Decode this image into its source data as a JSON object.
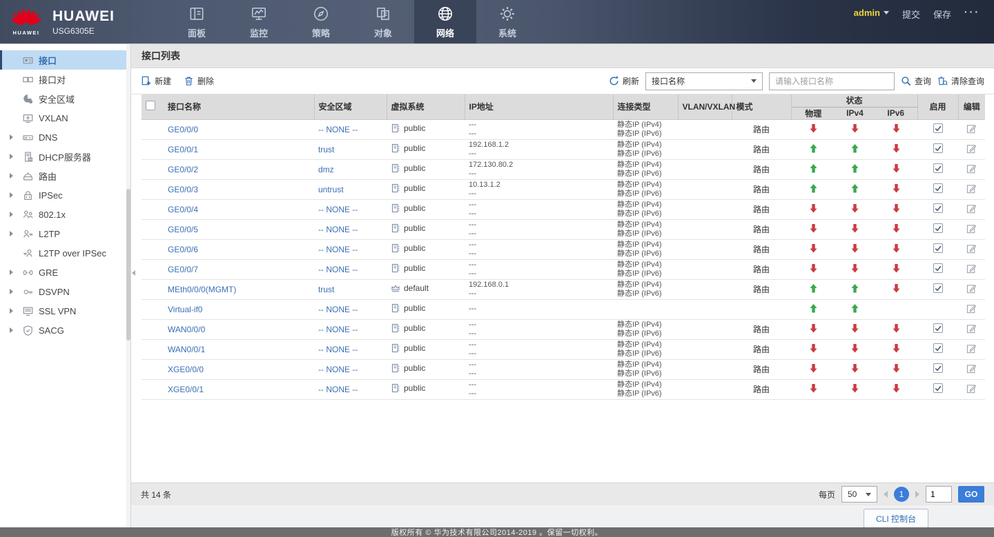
{
  "colors": {
    "brand_red": "#e2001a",
    "accent_blue": "#2f6eb5",
    "link_blue": "#3a6fb5",
    "up_green": "#3aa84c",
    "down_red": "#cc3a41",
    "admin_yellow": "#f0d43c",
    "go_blue": "#3b7dd8",
    "selected_bg": "#bfdbf3"
  },
  "brand": {
    "logo_caption": "HUAWEI",
    "name": "HUAWEI",
    "model": "USG6305E"
  },
  "topnav": {
    "items": [
      {
        "id": "dashboard",
        "label": "面板",
        "icon": "dashboard-icon",
        "active": false
      },
      {
        "id": "monitor",
        "label": "监控",
        "icon": "monitor-icon",
        "active": false
      },
      {
        "id": "policy",
        "label": "策略",
        "icon": "policy-icon",
        "active": false
      },
      {
        "id": "object",
        "label": "对象",
        "icon": "object-icon",
        "active": false
      },
      {
        "id": "network",
        "label": "网络",
        "icon": "network-icon",
        "active": true
      },
      {
        "id": "system",
        "label": "系统",
        "icon": "system-icon",
        "active": false
      }
    ],
    "user": "admin",
    "commit_label": "提交",
    "save_label": "保存",
    "more_label": "···"
  },
  "sidebar": {
    "items": [
      {
        "id": "interface",
        "label": "接口",
        "icon": "interface-icon",
        "selected": true,
        "expandable": false
      },
      {
        "id": "interface-pair",
        "label": "接口对",
        "icon": "interface-pair-icon",
        "selected": false,
        "expandable": false
      },
      {
        "id": "security-zone",
        "label": "安全区域",
        "icon": "zone-icon",
        "selected": false,
        "expandable": false
      },
      {
        "id": "vxlan",
        "label": "VXLAN",
        "icon": "vxlan-icon",
        "selected": false,
        "expandable": false
      },
      {
        "id": "dns",
        "label": "DNS",
        "icon": "dns-icon",
        "selected": false,
        "expandable": true
      },
      {
        "id": "dhcp-server",
        "label": "DHCP服务器",
        "icon": "dhcp-icon",
        "selected": false,
        "expandable": true
      },
      {
        "id": "route",
        "label": "路由",
        "icon": "route-icon",
        "selected": false,
        "expandable": true
      },
      {
        "id": "ipsec",
        "label": "IPSec",
        "icon": "ipsec-icon",
        "selected": false,
        "expandable": true
      },
      {
        "id": "8021x",
        "label": "802.1x",
        "icon": "dot1x-icon",
        "selected": false,
        "expandable": true
      },
      {
        "id": "l2tp",
        "label": "L2TP",
        "icon": "l2tp-icon",
        "selected": false,
        "expandable": true
      },
      {
        "id": "l2tp-over-ipsec",
        "label": "L2TP over IPSec",
        "icon": "l2tp-ipsec-icon",
        "selected": false,
        "expandable": false
      },
      {
        "id": "gre",
        "label": "GRE",
        "icon": "gre-icon",
        "selected": false,
        "expandable": true
      },
      {
        "id": "dsvpn",
        "label": "DSVPN",
        "icon": "dsvpn-icon",
        "selected": false,
        "expandable": true
      },
      {
        "id": "ssl-vpn",
        "label": "SSL VPN",
        "icon": "sslvpn-icon",
        "selected": false,
        "expandable": true
      },
      {
        "id": "sacg",
        "label": "SACG",
        "icon": "sacg-icon",
        "selected": false,
        "expandable": true
      }
    ]
  },
  "main": {
    "title": "接口列表",
    "toolbar": {
      "new_label": "新建",
      "delete_label": "删除",
      "refresh_label": "刷新",
      "filter_selected": "接口名称",
      "search_placeholder": "请输入接口名称",
      "query_label": "查询",
      "clear_query_label": "清除查询"
    },
    "table": {
      "headers": {
        "name": "接口名称",
        "zone": "安全区域",
        "vsys": "虚拟系统",
        "ip": "IP地址",
        "conn": "连接类型",
        "vlan": "VLAN/VXLAN",
        "mode": "模式",
        "status": "状态",
        "phys": "物理",
        "ipv4": "IPv4",
        "ipv6": "IPv6",
        "enable": "启用",
        "edit": "编辑"
      },
      "rows": [
        {
          "name": "GE0/0/0",
          "zone": "-- NONE --",
          "vsys": "public",
          "vsys_icon": "vsys-public-icon",
          "ip": [
            "---",
            "---"
          ],
          "conn": [
            "静态IP (IPv4)",
            "静态IP (IPv6)"
          ],
          "vlan": "",
          "mode": "路由",
          "status_phys": "down",
          "status_ipv4": "down",
          "status_ipv6": "down",
          "enabled": true
        },
        {
          "name": "GE0/0/1",
          "zone": "trust",
          "vsys": "public",
          "vsys_icon": "vsys-public-icon",
          "ip": [
            "192.168.1.2",
            "---"
          ],
          "conn": [
            "静态IP (IPv4)",
            "静态IP (IPv6)"
          ],
          "vlan": "",
          "mode": "路由",
          "status_phys": "up",
          "status_ipv4": "up",
          "status_ipv6": "down",
          "enabled": true
        },
        {
          "name": "GE0/0/2",
          "zone": "dmz",
          "vsys": "public",
          "vsys_icon": "vsys-public-icon",
          "ip": [
            "172.130.80.2",
            "---"
          ],
          "conn": [
            "静态IP (IPv4)",
            "静态IP (IPv6)"
          ],
          "vlan": "",
          "mode": "路由",
          "status_phys": "up",
          "status_ipv4": "up",
          "status_ipv6": "down",
          "enabled": true
        },
        {
          "name": "GE0/0/3",
          "zone": "untrust",
          "vsys": "public",
          "vsys_icon": "vsys-public-icon",
          "ip": [
            "10.13.1.2",
            "---"
          ],
          "conn": [
            "静态IP (IPv4)",
            "静态IP (IPv6)"
          ],
          "vlan": "",
          "mode": "路由",
          "status_phys": "up",
          "status_ipv4": "up",
          "status_ipv6": "down",
          "enabled": true
        },
        {
          "name": "GE0/0/4",
          "zone": "-- NONE --",
          "vsys": "public",
          "vsys_icon": "vsys-public-icon",
          "ip": [
            "---",
            "---"
          ],
          "conn": [
            "静态IP (IPv4)",
            "静态IP (IPv6)"
          ],
          "vlan": "",
          "mode": "路由",
          "status_phys": "down",
          "status_ipv4": "down",
          "status_ipv6": "down",
          "enabled": true
        },
        {
          "name": "GE0/0/5",
          "zone": "-- NONE --",
          "vsys": "public",
          "vsys_icon": "vsys-public-icon",
          "ip": [
            "---",
            "---"
          ],
          "conn": [
            "静态IP (IPv4)",
            "静态IP (IPv6)"
          ],
          "vlan": "",
          "mode": "路由",
          "status_phys": "down",
          "status_ipv4": "down",
          "status_ipv6": "down",
          "enabled": true
        },
        {
          "name": "GE0/0/6",
          "zone": "-- NONE --",
          "vsys": "public",
          "vsys_icon": "vsys-public-icon",
          "ip": [
            "---",
            "---"
          ],
          "conn": [
            "静态IP (IPv4)",
            "静态IP (IPv6)"
          ],
          "vlan": "",
          "mode": "路由",
          "status_phys": "down",
          "status_ipv4": "down",
          "status_ipv6": "down",
          "enabled": true
        },
        {
          "name": "GE0/0/7",
          "zone": "-- NONE --",
          "vsys": "public",
          "vsys_icon": "vsys-public-icon",
          "ip": [
            "---",
            "---"
          ],
          "conn": [
            "静态IP (IPv4)",
            "静态IP (IPv6)"
          ],
          "vlan": "",
          "mode": "路由",
          "status_phys": "down",
          "status_ipv4": "down",
          "status_ipv6": "down",
          "enabled": true
        },
        {
          "name": "MEth0/0/0(MGMT)",
          "zone": "trust",
          "vsys": "default",
          "vsys_icon": "vsys-default-icon",
          "ip": [
            "192.168.0.1",
            "---"
          ],
          "conn": [
            "静态IP (IPv4)",
            "静态IP (IPv6)"
          ],
          "vlan": "",
          "mode": "路由",
          "status_phys": "up",
          "status_ipv4": "up",
          "status_ipv6": "down",
          "enabled": true
        },
        {
          "name": "Virtual-if0",
          "zone": "-- NONE --",
          "vsys": "public",
          "vsys_icon": "vsys-public-icon",
          "ip": [
            "---"
          ],
          "conn": [],
          "vlan": "",
          "mode": "",
          "status_phys": "up",
          "status_ipv4": "up",
          "status_ipv6": "",
          "enabled": null
        },
        {
          "name": "WAN0/0/0",
          "zone": "-- NONE --",
          "vsys": "public",
          "vsys_icon": "vsys-public-icon",
          "ip": [
            "---",
            "---"
          ],
          "conn": [
            "静态IP (IPv4)",
            "静态IP (IPv6)"
          ],
          "vlan": "",
          "mode": "路由",
          "status_phys": "down",
          "status_ipv4": "down",
          "status_ipv6": "down",
          "enabled": true
        },
        {
          "name": "WAN0/0/1",
          "zone": "-- NONE --",
          "vsys": "public",
          "vsys_icon": "vsys-public-icon",
          "ip": [
            "---",
            "---"
          ],
          "conn": [
            "静态IP (IPv4)",
            "静态IP (IPv6)"
          ],
          "vlan": "",
          "mode": "路由",
          "status_phys": "down",
          "status_ipv4": "down",
          "status_ipv6": "down",
          "enabled": true
        },
        {
          "name": "XGE0/0/0",
          "zone": "-- NONE --",
          "vsys": "public",
          "vsys_icon": "vsys-public-icon",
          "ip": [
            "---",
            "---"
          ],
          "conn": [
            "静态IP (IPv4)",
            "静态IP (IPv6)"
          ],
          "vlan": "",
          "mode": "路由",
          "status_phys": "down",
          "status_ipv4": "down",
          "status_ipv6": "down",
          "enabled": true
        },
        {
          "name": "XGE0/0/1",
          "zone": "-- NONE --",
          "vsys": "public",
          "vsys_icon": "vsys-public-icon",
          "ip": [
            "---",
            "---"
          ],
          "conn": [
            "静态IP (IPv4)",
            "静态IP (IPv6)"
          ],
          "vlan": "",
          "mode": "路由",
          "status_phys": "down",
          "status_ipv4": "down",
          "status_ipv6": "down",
          "enabled": true
        }
      ]
    },
    "footer": {
      "total_label": "共 14 条",
      "per_page_label": "每页",
      "per_page_value": "50",
      "page_current": "1",
      "goto_value": "1",
      "go_label": "GO"
    }
  },
  "bottom": {
    "cli_label": "CLI 控制台",
    "copyright": "版权所有 © 华为技术有限公司2014-2019 。保留一切权利。"
  }
}
